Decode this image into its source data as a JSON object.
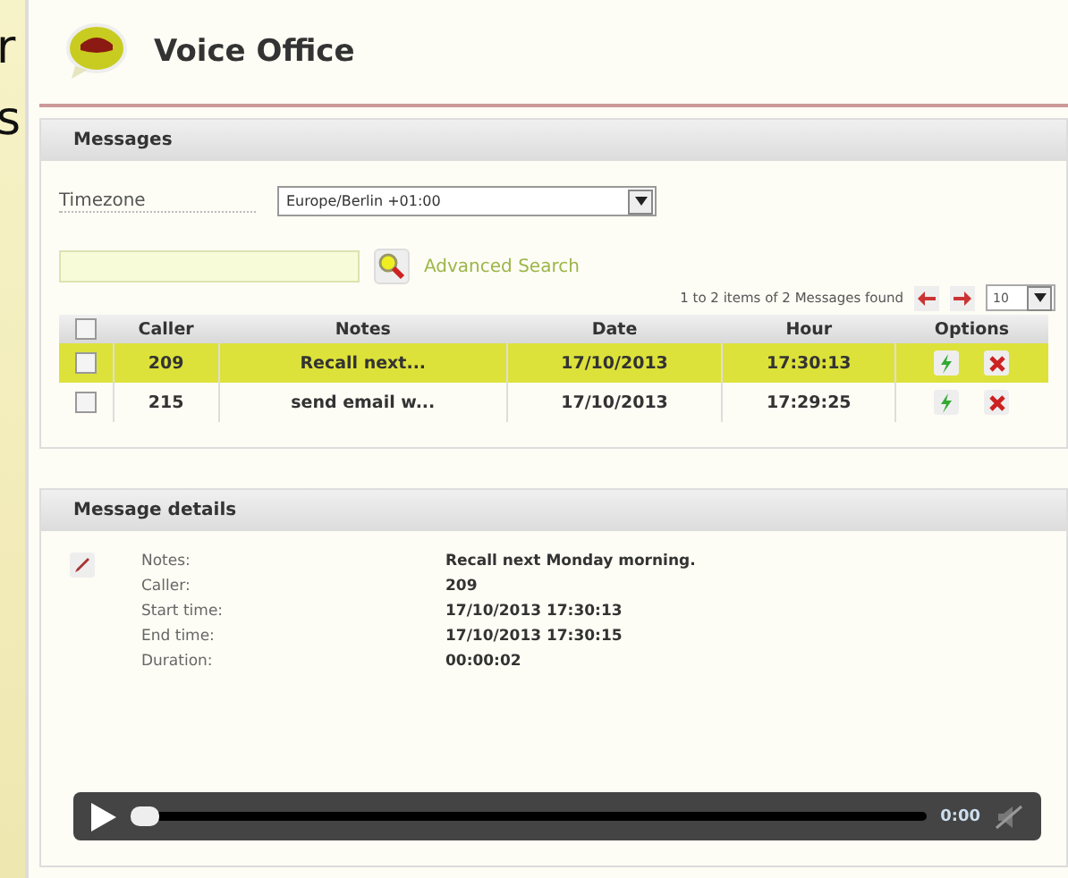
{
  "edge_text": [
    "r",
    "s"
  ],
  "app": {
    "title": "Voice Office"
  },
  "messages": {
    "title": "Messages",
    "timezone": {
      "label": "Timezone",
      "value": "Europe/Berlin +01:00"
    },
    "search": {
      "link": "Advanced Search"
    },
    "pagination": {
      "summary": "1 to 2 items of 2 Messages found",
      "page_size": "10"
    },
    "table": {
      "header_checked": false,
      "columns": [
        "Caller",
        "Notes",
        "Date",
        "Hour",
        "Options"
      ],
      "rows": [
        {
          "selected": true,
          "checked": false,
          "caller": "209",
          "notes": "Recall next...",
          "date": "17/10/2013",
          "hour": "17:30:13"
        },
        {
          "selected": false,
          "checked": false,
          "caller": "215",
          "notes": "send email w...",
          "date": "17/10/2013",
          "hour": "17:29:25"
        }
      ]
    }
  },
  "details": {
    "title": "Message details",
    "fields": [
      {
        "label": "Notes:",
        "value": "Recall next Monday morning."
      },
      {
        "label": "Caller:",
        "value": "209"
      },
      {
        "label": "Start time:",
        "value": "17/10/2013 17:30:13"
      },
      {
        "label": "End time:",
        "value": "17/10/2013 17:30:15"
      },
      {
        "label": "Duration:",
        "value": "00:00:02"
      }
    ],
    "player": {
      "level": 0.0,
      "time": "0:00"
    }
  }
}
